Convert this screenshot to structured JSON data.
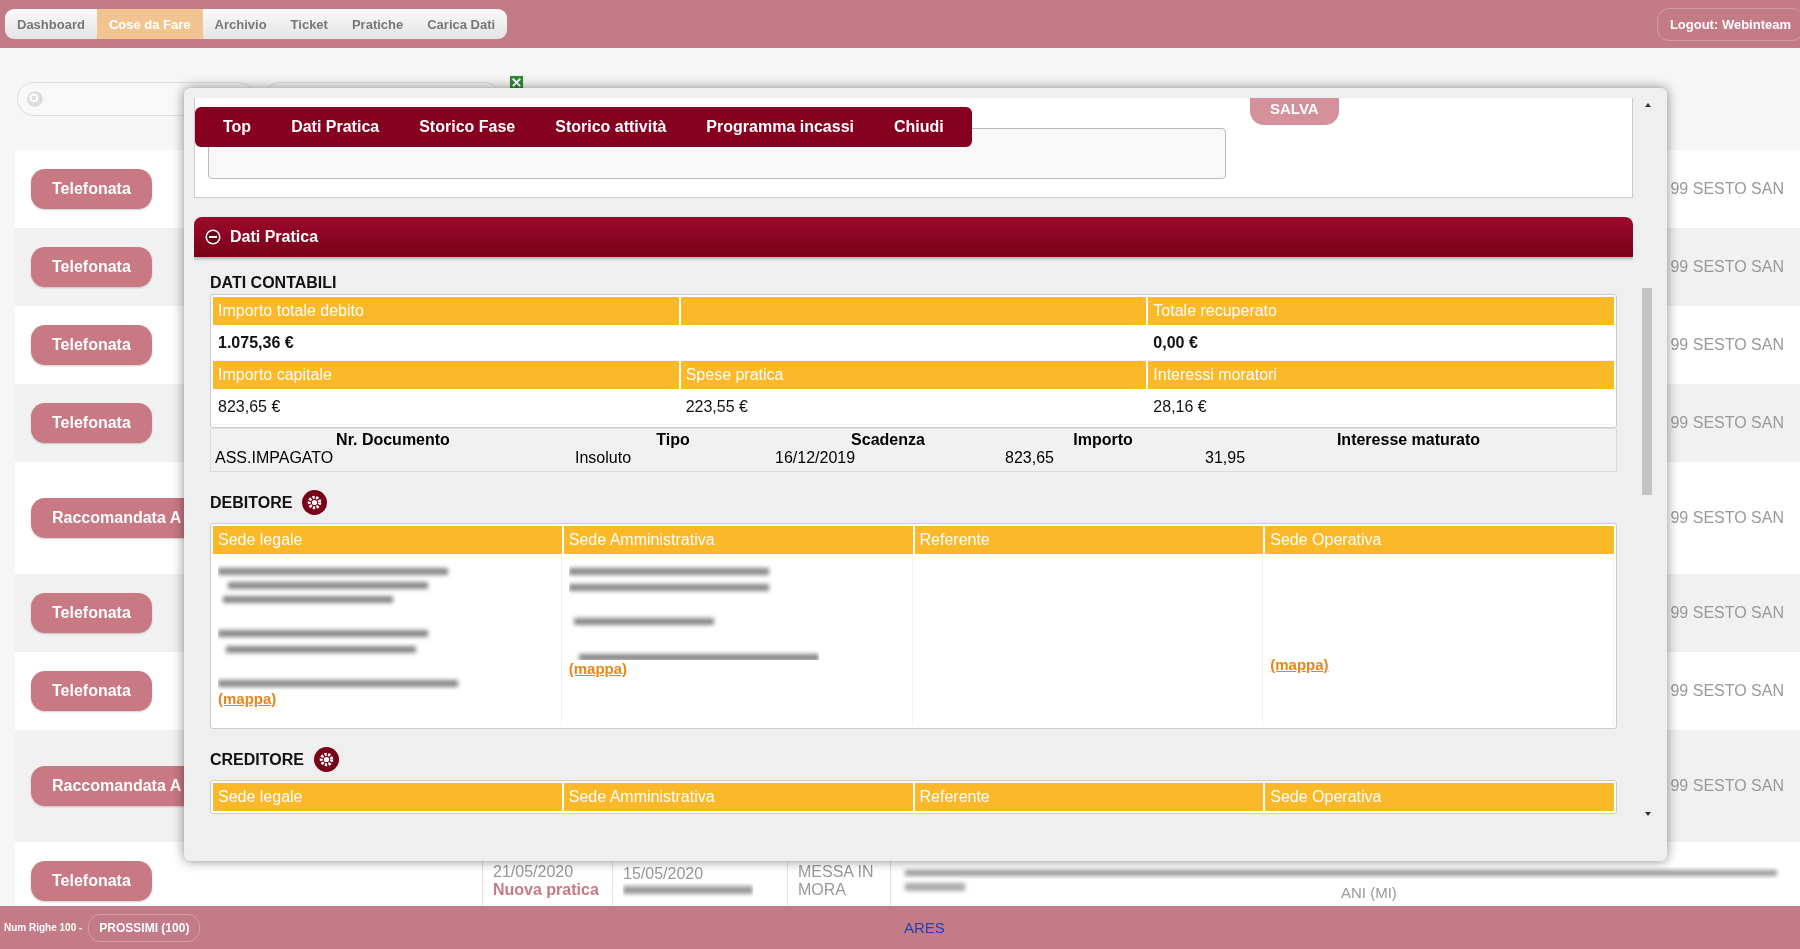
{
  "nav": {
    "tabs": [
      {
        "label": "Dashboard",
        "selected": false
      },
      {
        "label": "Cose da Fare",
        "selected": true
      },
      {
        "label": "Archivio",
        "selected": false
      },
      {
        "label": "Ticket",
        "selected": false
      },
      {
        "label": "Pratiche",
        "selected": false
      },
      {
        "label": "Carica Dati",
        "selected": false
      }
    ],
    "logout": "Logout: Webinteam"
  },
  "rows": [
    {
      "action": "Telefonata",
      "address": "99 SESTO SAN",
      "tall": false
    },
    {
      "action": "Telefonata",
      "address": "99 SESTO SAN",
      "tall": false
    },
    {
      "action": "Telefonata",
      "address": "99 SESTO SAN",
      "tall": false
    },
    {
      "action": "Telefonata",
      "address": "99 SESTO SAN",
      "tall": false
    },
    {
      "action": "Raccomandata A",
      "address": "99 SESTO SAN",
      "tall": true
    },
    {
      "action": "Telefonata",
      "address": "99 SESTO SAN",
      "tall": false
    },
    {
      "action": "Telefonata",
      "address": "99 SESTO SAN",
      "tall": false
    },
    {
      "action": "Raccomandata A",
      "address": "99 SESTO SAN",
      "tall": true
    },
    {
      "action": "Telefonata",
      "date_1": "21/05/2020",
      "status": "Nuova pratica",
      "date_2": "15/05/2020",
      "phase": "MESSA IN MORA",
      "address": "ANI (MI)",
      "tall": false
    }
  ],
  "modal": {
    "save": "SALVA",
    "menu": [
      "Top",
      "Dati Pratica",
      "Storico Fase",
      "Storico attività",
      "Programma incassi",
      "Chiudi"
    ],
    "section": {
      "title": "Dati Pratica",
      "expanded": true
    },
    "accounting": {
      "heading": "DATI CONTABILI",
      "rows": [
        {
          "kind": "header",
          "cells": [
            "Importo totale debito",
            "",
            "Totale recuperato"
          ]
        },
        {
          "kind": "value",
          "bold": true,
          "cells": [
            "1.075,36 €",
            "",
            "0,00 €"
          ]
        },
        {
          "kind": "header",
          "cells": [
            "Importo capitale",
            "Spese pratica",
            "Interessi moratori"
          ]
        },
        {
          "kind": "value",
          "bold": false,
          "cells": [
            "823,65 €",
            "223,55 €",
            "28,16 €"
          ]
        }
      ]
    },
    "documents": {
      "columns": [
        "Nr. Documento",
        "Tipo",
        "Scadenza",
        "Importo",
        "Interesse maturato"
      ],
      "rows": [
        [
          "ASS.IMPAGATO",
          "Insoluto",
          "16/12/2019",
          "823,65",
          "31,95"
        ]
      ]
    },
    "debtor": {
      "heading": "DEBITORE",
      "columns": [
        {
          "title": "Sede legale",
          "redacted": true,
          "link": "(mappa)"
        },
        {
          "title": "Sede Amministrativa",
          "redacted": true,
          "link": "(mappa)"
        },
        {
          "title": "Referente",
          "redacted": false
        },
        {
          "title": "Sede Operativa",
          "redacted": false,
          "link": "(mappa)"
        }
      ]
    },
    "creditor": {
      "heading": "CREDITORE",
      "columns": [
        "Sede legale",
        "Sede Amministrativa",
        "Referente",
        "Sede Operativa"
      ]
    }
  },
  "footer": {
    "rows_label": "Num Righe 100 -",
    "next": "PROSSIMI (100)",
    "brand": "ARES"
  }
}
